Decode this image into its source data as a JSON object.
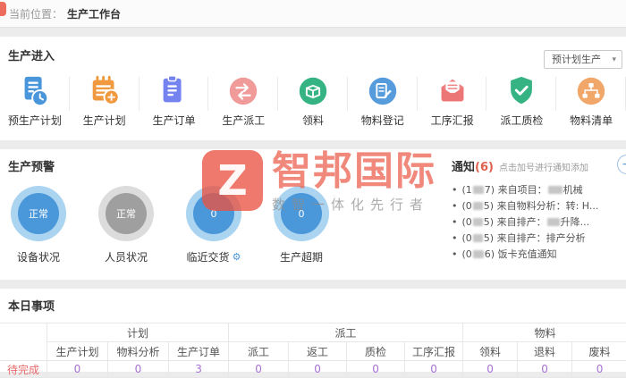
{
  "breadcrumb": {
    "label": "当前位置：",
    "current": "生产工作台"
  },
  "production_entry": {
    "title": "生产进入",
    "dropdown_value": "预计划生产",
    "dropdown_arrow": "▾",
    "items": [
      {
        "label": "预生产计划",
        "icon": "pre-plan-doc-clock-icon"
      },
      {
        "label": "生产计划",
        "icon": "plan-calendar-plus-icon"
      },
      {
        "label": "生产订单",
        "icon": "order-clipboard-icon"
      },
      {
        "label": "生产派工",
        "icon": "dispatch-arrows-icon"
      },
      {
        "label": "领料",
        "icon": "material-pick-box-icon"
      },
      {
        "label": "物料登记",
        "icon": "material-register-doc-icon"
      },
      {
        "label": "工序汇报",
        "icon": "process-report-mail-icon"
      },
      {
        "label": "派工质检",
        "icon": "qc-shield-check-icon"
      },
      {
        "label": "物料清单",
        "icon": "bom-sitemap-icon"
      }
    ]
  },
  "production_warning": {
    "title": "生产预警",
    "gear_glyph": "⚙",
    "gauges": [
      {
        "label": "设备状况",
        "value": "正常",
        "variant": "blue",
        "gear": false
      },
      {
        "label": "人员状况",
        "value": "正常",
        "variant": "gray",
        "gear": false
      },
      {
        "label": "临近交货",
        "value": "0",
        "variant": "blue",
        "gear": true
      },
      {
        "label": "生产超期",
        "value": "0",
        "variant": "blue",
        "gear": false
      }
    ]
  },
  "notices": {
    "title": "通知",
    "count": "(6)",
    "hint": "点击加号进行通知添加",
    "add_label": "+",
    "bullet": "•",
    "items": [
      {
        "segments": [
          {
            "t": "(1"
          },
          {
            "r": true,
            "w": 12
          },
          {
            "t": "7) 来自项目："
          },
          {
            "r": true,
            "w": 16
          },
          {
            "t": "机械"
          }
        ]
      },
      {
        "segments": [
          {
            "t": "(0"
          },
          {
            "r": true,
            "w": 11
          },
          {
            "t": "5) 来自物料分析：转: H..."
          }
        ]
      },
      {
        "segments": [
          {
            "t": "(0"
          },
          {
            "r": true,
            "w": 11
          },
          {
            "t": "5) 来自排产："
          },
          {
            "r": true,
            "w": 14
          },
          {
            "t": "升降..."
          }
        ]
      },
      {
        "segments": [
          {
            "t": "(0"
          },
          {
            "r": true,
            "w": 11
          },
          {
            "t": "5) 来自排产：排产分析"
          }
        ]
      },
      {
        "segments": [
          {
            "t": "(0"
          },
          {
            "r": true,
            "w": 12
          },
          {
            "t": "6) 饭卡充值通知"
          }
        ]
      }
    ]
  },
  "watermark": {
    "logo_letter": "Z",
    "brand": "智邦国际",
    "slogan": "数智一体化先行者"
  },
  "today": {
    "title": "本日事项",
    "groups": [
      {
        "label": "计划",
        "span": 3
      },
      {
        "label": "派工",
        "span": 4
      },
      {
        "label": "物料",
        "span": 3
      }
    ],
    "columns": [
      "生产计划",
      "物料分析",
      "生产订单",
      "派工",
      "返工",
      "质检",
      "工序汇报",
      "领料",
      "退料",
      "废料"
    ],
    "row": {
      "label": "待完成",
      "values": [
        "0",
        "0",
        "3",
        "0",
        "0",
        "0",
        "0",
        "0",
        "0",
        "0"
      ]
    }
  },
  "colors": {
    "accent_blue": "#4a96db",
    "warn_red": "#e0604f",
    "link_purple": "#a571d1",
    "brand_red": "#e95342",
    "gauge_blue": "#4a97d9",
    "gauge_gray": "#9f9f9f"
  }
}
